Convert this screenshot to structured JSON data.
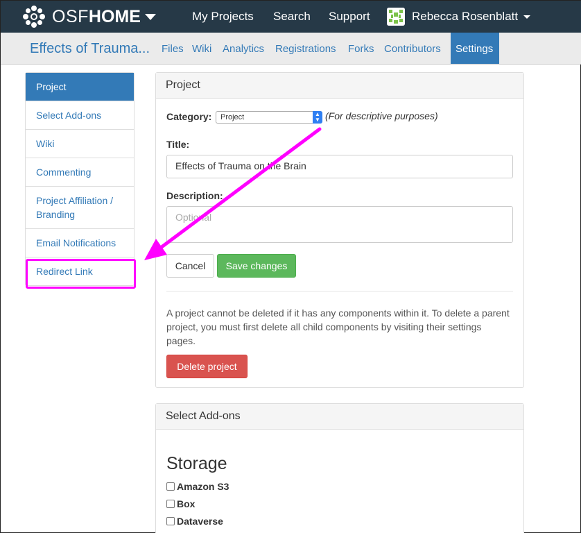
{
  "brand": {
    "osf": "OSF",
    "home": "HOME"
  },
  "topnav": {
    "my_projects": "My Projects",
    "search": "Search",
    "support": "Support",
    "user_name": "Rebecca Rosenblatt"
  },
  "project_nav": {
    "title": "Effects of Trauma...",
    "files": "Files",
    "wiki": "Wiki",
    "analytics": "Analytics",
    "registrations": "Registrations",
    "forks": "Forks",
    "contributors": "Contributors",
    "settings": "Settings"
  },
  "sidebar": {
    "items": [
      {
        "label": "Project"
      },
      {
        "label": "Select Add-ons"
      },
      {
        "label": "Wiki"
      },
      {
        "label": "Commenting"
      },
      {
        "label": "Project Affiliation / Branding"
      },
      {
        "label": "Email Notifications"
      },
      {
        "label": "Redirect Link"
      }
    ]
  },
  "project_panel": {
    "heading": "Project",
    "category_label": "Category:",
    "category_value": "Project",
    "category_hint": "(For descriptive purposes)",
    "title_label": "Title:",
    "title_value": "Effects of Trauma on the Brain",
    "description_label": "Description:",
    "description_placeholder": "Optional",
    "cancel": "Cancel",
    "save": "Save changes",
    "delete_note": "A project cannot be deleted if it has any components within it. To delete a parent project, you must first delete all child components by visiting their settings pages.",
    "delete": "Delete project"
  },
  "addons_panel": {
    "heading": "Select Add-ons",
    "storage_heading": "Storage",
    "options": [
      {
        "label": "Amazon S3"
      },
      {
        "label": "Box"
      },
      {
        "label": "Dataverse"
      }
    ]
  },
  "colors": {
    "navbar": "#263947",
    "link": "#337ab7",
    "highlight": "#ff00ff",
    "success": "#5cb85c",
    "danger": "#d9534f"
  }
}
